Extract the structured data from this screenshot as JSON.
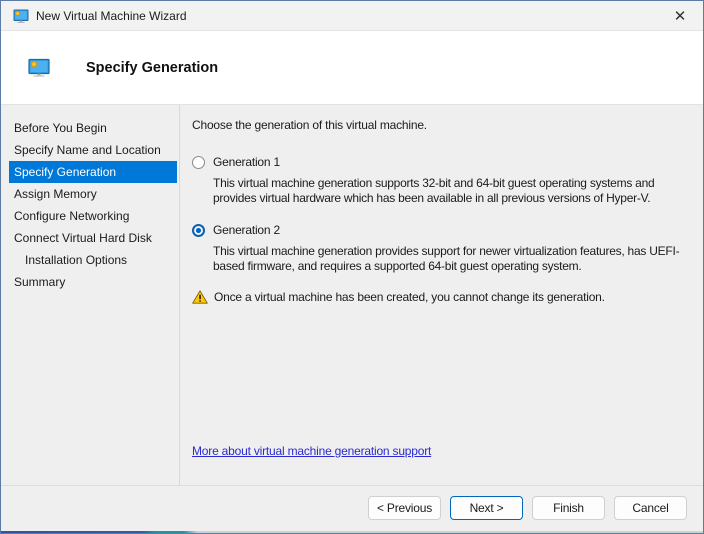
{
  "window": {
    "title": "New Virtual Machine Wizard"
  },
  "icons": {
    "close": "✕",
    "app": "vm-monitor",
    "warning": "!"
  },
  "header": {
    "title": "Specify Generation"
  },
  "sidebar": {
    "items": [
      {
        "label": "Before You Begin",
        "selected": false,
        "indent": false
      },
      {
        "label": "Specify Name and Location",
        "selected": false,
        "indent": false
      },
      {
        "label": "Specify Generation",
        "selected": true,
        "indent": false
      },
      {
        "label": "Assign Memory",
        "selected": false,
        "indent": false
      },
      {
        "label": "Configure Networking",
        "selected": false,
        "indent": false
      },
      {
        "label": "Connect Virtual Hard Disk",
        "selected": false,
        "indent": false
      },
      {
        "label": "Installation Options",
        "selected": false,
        "indent": true
      },
      {
        "label": "Summary",
        "selected": false,
        "indent": false
      }
    ]
  },
  "content": {
    "intro": "Choose the generation of this virtual machine.",
    "options": [
      {
        "label": "Generation 1",
        "selected": false,
        "description": "This virtual machine generation supports 32-bit and 64-bit guest operating systems and provides virtual hardware which has been available in all previous versions of Hyper-V."
      },
      {
        "label": "Generation 2",
        "selected": true,
        "description": "This virtual machine generation provides support for newer virtualization features, has UEFI-based firmware, and requires a supported 64-bit guest operating system."
      }
    ],
    "warning": "Once a virtual machine has been created, you cannot change its generation.",
    "link": "More about virtual machine generation support"
  },
  "footer": {
    "buttons": [
      {
        "label": "< Previous",
        "default": false
      },
      {
        "label": "Next >",
        "default": true
      },
      {
        "label": "Finish",
        "default": false
      },
      {
        "label": "Cancel",
        "default": false
      }
    ]
  },
  "colors": {
    "accent_selected": "#0078d7",
    "default_button_border": "#0067c0",
    "link": "#2a2ad0",
    "warning_yellow": "#fcc70e",
    "window_border": "#5a7ba6"
  }
}
